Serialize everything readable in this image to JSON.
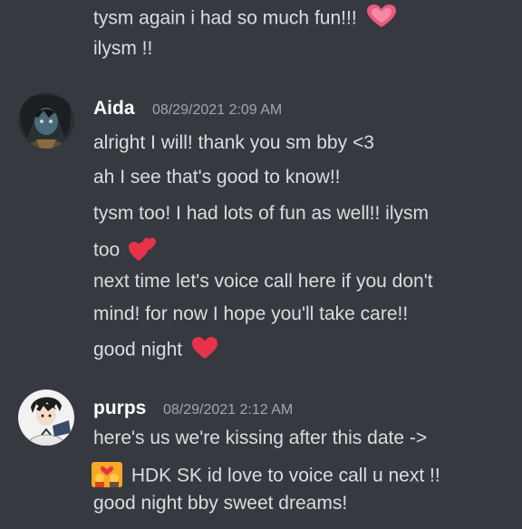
{
  "prev_messages": [
    "tysm again i had so much fun!!!",
    "ilysm !!"
  ],
  "aida": {
    "author": "Aida",
    "timestamp": "08/29/2021 2:09 AM",
    "lines": [
      "alright I will! thank you sm bby <3",
      "ah I see that's good to know!!",
      "tysm too! I had lots of fun as well!! ilysm",
      "too",
      "next time let's voice call here if you don't",
      "mind! for now I hope you'll take care!!",
      "good night"
    ]
  },
  "purps": {
    "author": "purps",
    "timestamp": "08/29/2021 2:12 AM",
    "lines": [
      "here's us we're kissing after this date ->",
      "HDK SK id love to voice call u next !!",
      "good night bby sweet dreams!"
    ]
  },
  "icons": {
    "heart_pink": "growing-heart-icon",
    "two_hearts": "two-hearts-icon",
    "red_heart": "red-heart-icon",
    "kiss_emoji": "couple-kiss-icon"
  },
  "colors": {
    "background": "#36393f",
    "text": "#dcddde",
    "author": "#ffffff",
    "timestamp": "#a3a6aa"
  }
}
